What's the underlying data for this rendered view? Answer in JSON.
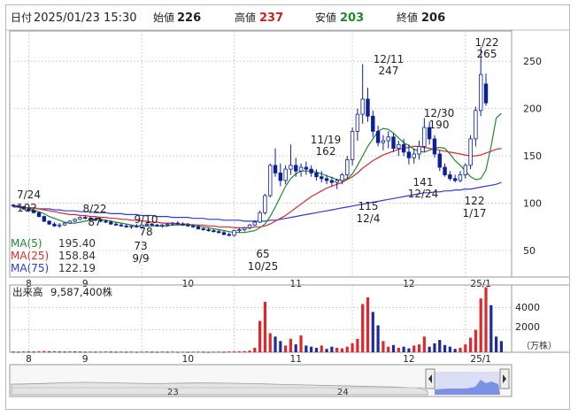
{
  "header": {
    "date_label": "日付",
    "datetime": "2025/01/23 15:30",
    "open_label": "始値",
    "open": "226",
    "high_label": "高値",
    "high": "237",
    "low_label": "安値",
    "low": "203",
    "close_label": "終値",
    "close": "206"
  },
  "colors": {
    "up": "#0b1f9e",
    "down": "#0b1f9e",
    "ma5": "#1f8a2c",
    "ma25": "#e0282c",
    "ma75": "#2e3bd6",
    "vol_up": "#e0282c",
    "vol_down": "#1f2a9e",
    "high_value": "#d0201d",
    "low_value": "#1f8a2c"
  },
  "legend": {
    "ma5": "MA(5)",
    "ma5_value": "195.40",
    "ma25": "MA(25)",
    "ma25_value": "158.84",
    "ma75": "MA(75)",
    "ma75_value": "122.19"
  },
  "volume_panel": {
    "label": "出来高",
    "value": "9,587,400株",
    "unit": "（万株）",
    "ticks": [
      "4000",
      "2000"
    ]
  },
  "navigator": {
    "year_labels": [
      "23",
      "24"
    ],
    "left_handle": "left-arrow-icon",
    "right_handle": "right-arrow-icon"
  },
  "chart_data": {
    "type": "candlestick",
    "y_ticks": [
      50,
      100,
      150,
      200,
      250
    ],
    "ylim": [
      22,
      282
    ],
    "month_labels": [
      "8",
      "9",
      "10",
      "11",
      "12",
      "25/1"
    ],
    "annotations": [
      {
        "date": "7/24",
        "value": "102"
      },
      {
        "date": "8/22",
        "value": "87"
      },
      {
        "date": "9/10",
        "value": "78"
      },
      {
        "date": "9/9",
        "value": "73"
      },
      {
        "date": "10/25",
        "value": "65"
      },
      {
        "date": "11/19",
        "value": "162"
      },
      {
        "date": "12/4",
        "value": "115"
      },
      {
        "date": "12/11",
        "value": "247"
      },
      {
        "date": "12/24",
        "value": "141"
      },
      {
        "date": "12/30",
        "value": "190"
      },
      {
        "date": "1/17",
        "value": "122"
      },
      {
        "date": "1/22",
        "value": "265"
      }
    ],
    "candles": [
      [
        98,
        99,
        96,
        97
      ],
      [
        97,
        98,
        95,
        96
      ],
      [
        96,
        97,
        93,
        94
      ],
      [
        94,
        95,
        91,
        92
      ],
      [
        92,
        93,
        89,
        90
      ],
      [
        90,
        91,
        85,
        86
      ],
      [
        86,
        87,
        80,
        81
      ],
      [
        81,
        82,
        77,
        78
      ],
      [
        78,
        80,
        75,
        76
      ],
      [
        76,
        79,
        74,
        77
      ],
      [
        77,
        80,
        76,
        79
      ],
      [
        79,
        82,
        78,
        81
      ],
      [
        81,
        84,
        80,
        83
      ],
      [
        83,
        86,
        82,
        85
      ],
      [
        85,
        87,
        83,
        84
      ],
      [
        84,
        86,
        82,
        83
      ],
      [
        83,
        85,
        81,
        82
      ],
      [
        82,
        84,
        80,
        81
      ],
      [
        81,
        83,
        79,
        80
      ],
      [
        80,
        82,
        77,
        78
      ],
      [
        78,
        80,
        76,
        77
      ],
      [
        77,
        79,
        75,
        76
      ],
      [
        76,
        78,
        74,
        75
      ],
      [
        75,
        77,
        73,
        76
      ],
      [
        76,
        78,
        74,
        75
      ],
      [
        75,
        78,
        73,
        77
      ],
      [
        77,
        79,
        75,
        78
      ],
      [
        78,
        79,
        76,
        77
      ],
      [
        77,
        78,
        75,
        76
      ],
      [
        76,
        78,
        74,
        77
      ],
      [
        77,
        79,
        75,
        78
      ],
      [
        78,
        80,
        76,
        79
      ],
      [
        79,
        81,
        77,
        78
      ],
      [
        78,
        80,
        76,
        77
      ],
      [
        77,
        79,
        75,
        76
      ],
      [
        76,
        78,
        74,
        75
      ],
      [
        75,
        77,
        72,
        73
      ],
      [
        73,
        75,
        71,
        72
      ],
      [
        72,
        74,
        70,
        71
      ],
      [
        71,
        73,
        69,
        70
      ],
      [
        70,
        72,
        68,
        69
      ],
      [
        69,
        71,
        66,
        67
      ],
      [
        67,
        69,
        65,
        66
      ],
      [
        66,
        72,
        65,
        71
      ],
      [
        71,
        74,
        69,
        72
      ],
      [
        72,
        75,
        70,
        74
      ],
      [
        74,
        78,
        72,
        77
      ],
      [
        77,
        82,
        76,
        80
      ],
      [
        80,
        92,
        79,
        90
      ],
      [
        90,
        110,
        88,
        108
      ],
      [
        108,
        142,
        106,
        140
      ],
      [
        140,
        158,
        128,
        132
      ],
      [
        132,
        142,
        118,
        124
      ],
      [
        124,
        140,
        120,
        136
      ],
      [
        136,
        162,
        130,
        140
      ],
      [
        140,
        148,
        128,
        134
      ],
      [
        134,
        142,
        128,
        138
      ],
      [
        138,
        144,
        130,
        136
      ],
      [
        136,
        140,
        128,
        132
      ],
      [
        132,
        136,
        124,
        128
      ],
      [
        128,
        134,
        122,
        126
      ],
      [
        126,
        130,
        120,
        124
      ],
      [
        124,
        128,
        118,
        122
      ],
      [
        122,
        126,
        115,
        124
      ],
      [
        124,
        132,
        120,
        130
      ],
      [
        130,
        150,
        126,
        146
      ],
      [
        146,
        180,
        140,
        176
      ],
      [
        176,
        200,
        166,
        194
      ],
      [
        194,
        247,
        184,
        210
      ],
      [
        210,
        222,
        186,
        192
      ],
      [
        192,
        198,
        170,
        176
      ],
      [
        176,
        182,
        160,
        164
      ],
      [
        164,
        172,
        156,
        166
      ],
      [
        166,
        176,
        158,
        170
      ],
      [
        170,
        174,
        154,
        158
      ],
      [
        158,
        166,
        150,
        162
      ],
      [
        162,
        168,
        150,
        154
      ],
      [
        154,
        162,
        141,
        148
      ],
      [
        148,
        158,
        142,
        152
      ],
      [
        152,
        166,
        146,
        160
      ],
      [
        160,
        190,
        154,
        180
      ],
      [
        180,
        186,
        162,
        168
      ],
      [
        168,
        172,
        148,
        152
      ],
      [
        152,
        156,
        134,
        138
      ],
      [
        138,
        142,
        128,
        130
      ],
      [
        130,
        134,
        124,
        126
      ],
      [
        126,
        130,
        122,
        124
      ],
      [
        124,
        134,
        122,
        130
      ],
      [
        130,
        142,
        126,
        140
      ],
      [
        140,
        172,
        136,
        168
      ],
      [
        168,
        202,
        160,
        198
      ],
      [
        198,
        265,
        192,
        236
      ],
      [
        226,
        237,
        203,
        206
      ]
    ],
    "ma5": [
      98,
      97,
      96,
      95,
      93,
      91,
      89,
      86,
      84,
      82,
      80,
      79,
      79,
      80,
      81,
      82,
      83,
      83,
      82,
      81,
      80,
      79,
      78,
      77,
      76,
      76,
      76,
      76,
      76,
      76,
      76,
      77,
      77,
      77,
      77,
      77,
      76,
      75,
      74,
      73,
      72,
      71,
      70,
      69,
      69,
      69,
      70,
      71,
      74,
      78,
      86,
      96,
      107,
      118,
      126,
      131,
      134,
      134,
      134,
      133,
      131,
      129,
      127,
      125,
      124,
      126,
      131,
      140,
      150,
      160,
      168,
      176,
      179,
      178,
      174,
      169,
      164,
      161,
      157,
      155,
      154,
      156,
      158,
      159,
      158,
      152,
      145,
      140,
      134,
      128,
      125,
      126,
      135,
      160,
      190,
      195
    ],
    "ma25": [
      97,
      96,
      96,
      95,
      95,
      94,
      93,
      92,
      91,
      90,
      89,
      88,
      88,
      87,
      87,
      86,
      86,
      85,
      85,
      84,
      84,
      83,
      83,
      82,
      82,
      81,
      81,
      80,
      80,
      79,
      79,
      79,
      78,
      78,
      78,
      77,
      77,
      77,
      76,
      76,
      75,
      75,
      75,
      74,
      74,
      74,
      74,
      75,
      75,
      76,
      78,
      81,
      84,
      87,
      91,
      95,
      99,
      103,
      107,
      110,
      113,
      116,
      118,
      120,
      122,
      125,
      128,
      132,
      137,
      141,
      145,
      148,
      151,
      153,
      155,
      157,
      158,
      159,
      160,
      160,
      159,
      158,
      157,
      156,
      155,
      154,
      153,
      152,
      151,
      150,
      150,
      151,
      153,
      155,
      157,
      158
    ],
    "ma75": [
      96,
      96,
      95,
      95,
      95,
      94,
      94,
      94,
      93,
      93,
      92,
      92,
      92,
      91,
      91,
      91,
      90,
      90,
      90,
      89,
      89,
      89,
      88,
      88,
      88,
      87,
      87,
      87,
      86,
      86,
      86,
      85,
      85,
      85,
      85,
      84,
      84,
      84,
      83,
      83,
      83,
      82,
      82,
      82,
      82,
      81,
      81,
      81,
      81,
      81,
      82,
      82,
      83,
      84,
      85,
      86,
      87,
      88,
      89,
      90,
      91,
      92,
      93,
      94,
      95,
      96,
      97,
      98,
      99,
      100,
      101,
      102,
      103,
      104,
      105,
      106,
      107,
      108,
      109,
      110,
      111,
      111,
      112,
      112,
      113,
      113,
      114,
      114,
      115,
      115,
      116,
      117,
      118,
      119,
      120,
      122
    ],
    "volume": [
      60,
      50,
      80,
      70,
      60,
      90,
      110,
      80,
      90,
      70,
      60,
      80,
      70,
      60,
      50,
      60,
      50,
      60,
      70,
      60,
      50,
      60,
      50,
      60,
      40,
      60,
      70,
      50,
      40,
      60,
      50,
      60,
      40,
      50,
      40,
      50,
      60,
      50,
      40,
      50,
      60,
      50,
      70,
      80,
      90,
      100,
      150,
      400,
      2800,
      4500,
      1700,
      1400,
      1000,
      600,
      1200,
      700,
      1500,
      600,
      500,
      400,
      600,
      300,
      500,
      400,
      350,
      500,
      800,
      1200,
      4300,
      4900,
      3600,
      2400,
      1000,
      500,
      650,
      400,
      500,
      350,
      600,
      700,
      1400,
      500,
      800,
      1100,
      650,
      500,
      300,
      400,
      700,
      1300,
      2000,
      4800,
      5800,
      4200,
      1400,
      1000
    ],
    "volume_up": [
      0,
      0,
      1,
      0,
      0,
      1,
      1,
      0,
      1,
      0,
      0,
      1,
      0,
      0,
      0,
      1,
      0,
      1,
      1,
      0,
      0,
      1,
      0,
      1,
      0,
      1,
      1,
      0,
      0,
      1,
      0,
      1,
      0,
      1,
      0,
      1,
      1,
      0,
      0,
      1,
      1,
      0,
      1,
      1,
      1,
      1,
      1,
      1,
      1,
      1,
      1,
      0,
      0,
      1,
      1,
      0,
      1,
      0,
      0,
      0,
      1,
      0,
      0,
      1,
      1,
      1,
      1,
      1,
      1,
      1,
      0,
      0,
      1,
      1,
      0,
      1,
      0,
      0,
      1,
      1,
      1,
      0,
      0,
      0,
      0,
      0,
      0,
      1,
      1,
      1,
      1,
      1,
      1,
      0,
      0,
      0
    ],
    "vol_ylim": [
      0,
      6000
    ],
    "vol_ticks": [
      4000,
      2000
    ]
  }
}
